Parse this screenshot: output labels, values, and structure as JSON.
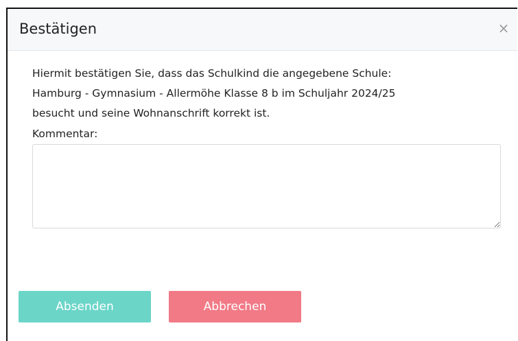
{
  "dialog": {
    "title": "Bestätigen",
    "close_icon": "×",
    "message_lines": [
      "Hiermit bestätigen Sie, dass das Schulkind die angegebene Schule:",
      "Hamburg - Gymnasium - Allermöhe Klasse 8 b im Schuljahr 2024/25",
      "besucht und seine Wohnanschrift korrekt ist."
    ],
    "comment_label": "Kommentar:",
    "comment_value": "",
    "submit_label": "Absenden",
    "cancel_label": "Abbrechen"
  },
  "colors": {
    "submit_button": "#6bd5c8",
    "cancel_button": "#f17a86",
    "header_background": "#f7f8fa"
  }
}
